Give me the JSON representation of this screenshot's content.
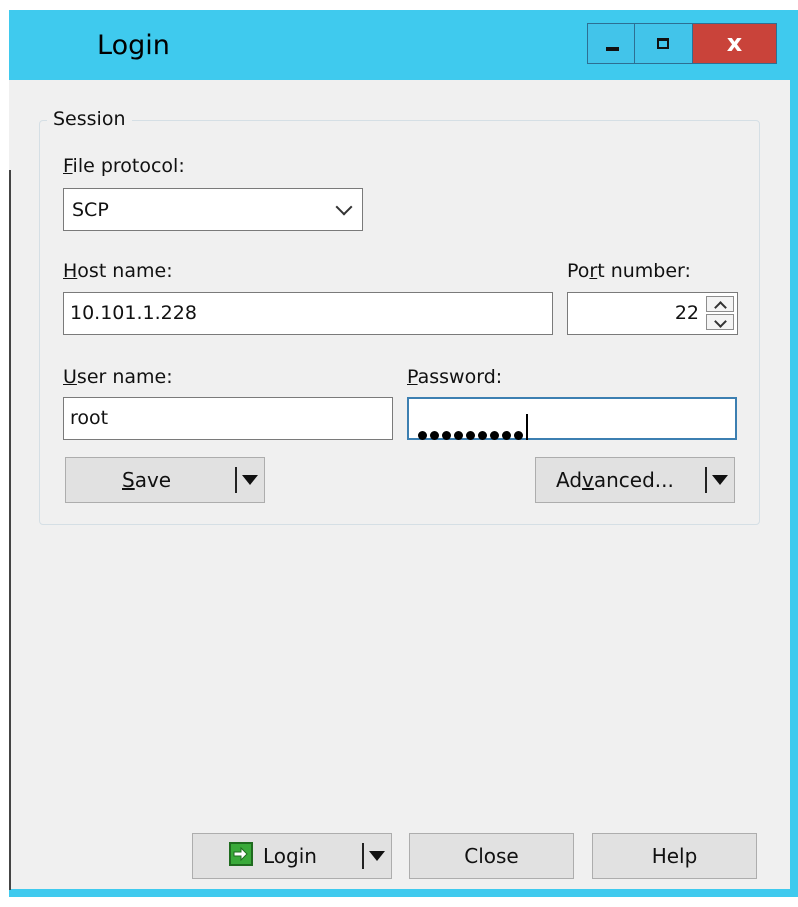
{
  "window": {
    "title": "Login",
    "close_glyph": "x"
  },
  "session": {
    "group_title": "Session",
    "file_protocol": {
      "label_underlined": "F",
      "label_rest": "ile protocol:",
      "value": "SCP"
    },
    "host_name": {
      "label_underlined": "H",
      "label_rest": "ost name:",
      "value": "10.101.1.228"
    },
    "port_number": {
      "label_pre": "Po",
      "label_underlined": "r",
      "label_rest": "t number:",
      "value": "22"
    },
    "user_name": {
      "label_underlined": "U",
      "label_rest": "ser name:",
      "value": "root"
    },
    "password": {
      "label_underlined": "P",
      "label_rest": "assword:",
      "masked_length": 9
    },
    "save_button": {
      "underlined": "S",
      "rest": "ave"
    },
    "advanced_button": {
      "pre": "Ad",
      "underlined": "v",
      "rest": "anced..."
    }
  },
  "footer": {
    "login_label": "Login",
    "close_label": "Close",
    "help_label": "Help"
  },
  "colors": {
    "title_bar": "#3fcaee",
    "close_button": "#c9433a",
    "login_icon": "#3aaa3a",
    "dialog_bg": "#f0f0f0"
  },
  "icons": [
    "minimize-icon",
    "maximize-icon",
    "close-icon",
    "chevron-down-icon",
    "spin-up-icon",
    "spin-down-icon",
    "split-dropdown-icon",
    "login-arrow-icon"
  ]
}
